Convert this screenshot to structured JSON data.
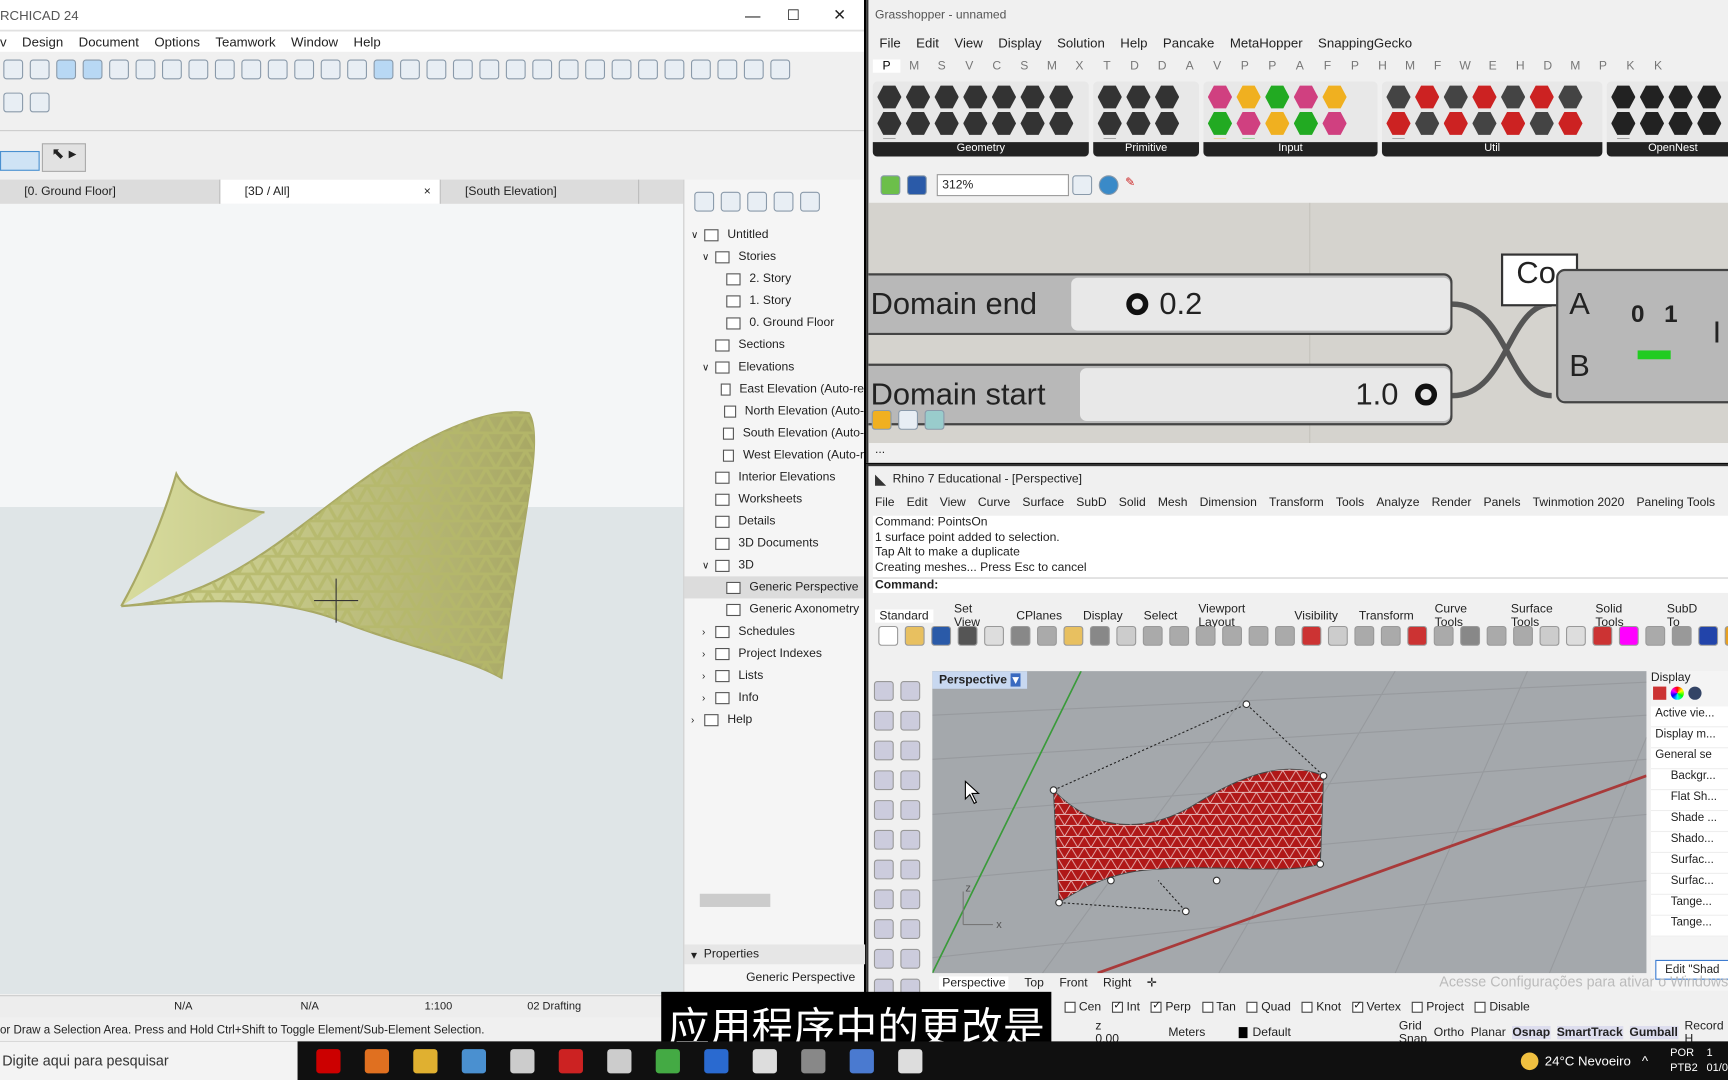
{
  "archicad": {
    "title": "RCHICAD 24",
    "menu": [
      "v",
      "Design",
      "Document",
      "Options",
      "Teamwork",
      "Window",
      "Help"
    ],
    "tabs": [
      {
        "label": "[0. Ground Floor]"
      },
      {
        "label": "[3D / All]",
        "close": "×"
      },
      {
        "label": "[South Elevation]"
      }
    ],
    "navigator": [
      {
        "label": "Untitled",
        "depth": 0,
        "exp": "v"
      },
      {
        "label": "Stories",
        "depth": 1,
        "exp": "v"
      },
      {
        "label": "2. Story",
        "depth": 2
      },
      {
        "label": "1. Story",
        "depth": 2
      },
      {
        "label": "0. Ground Floor",
        "depth": 2
      },
      {
        "label": "Sections",
        "depth": 1
      },
      {
        "label": "Elevations",
        "depth": 1,
        "exp": "v"
      },
      {
        "label": "East Elevation (Auto-re",
        "depth": 2
      },
      {
        "label": "North Elevation (Auto-",
        "depth": 2
      },
      {
        "label": "South Elevation (Auto-",
        "depth": 2
      },
      {
        "label": "West Elevation (Auto-r",
        "depth": 2
      },
      {
        "label": "Interior Elevations",
        "depth": 1
      },
      {
        "label": "Worksheets",
        "depth": 1
      },
      {
        "label": "Details",
        "depth": 1
      },
      {
        "label": "3D Documents",
        "depth": 1
      },
      {
        "label": "3D",
        "depth": 1,
        "exp": "v"
      },
      {
        "label": "Generic Perspective",
        "depth": 2,
        "selected": true
      },
      {
        "label": "Generic Axonometry",
        "depth": 2
      },
      {
        "label": "Schedules",
        "depth": 1,
        "exp": ">"
      },
      {
        "label": "Project Indexes",
        "depth": 1,
        "exp": ">"
      },
      {
        "label": "Lists",
        "depth": 1,
        "exp": ">"
      },
      {
        "label": "Info",
        "depth": 1,
        "exp": ">"
      },
      {
        "label": "Help",
        "depth": 0,
        "exp": ">"
      }
    ],
    "properties_label": "Properties",
    "properties_value": "Generic Perspective",
    "bottom": {
      "na1": "N/A",
      "na2": "N/A",
      "scale": "1:100",
      "layer": "02 Drafting"
    },
    "status": "or Draw a Selection Area. Press and Hold Ctrl+Shift to Toggle Element/Sub-Element Selection.",
    "mesh_color": "#b5b86a"
  },
  "grasshopper": {
    "title": "Grasshopper - unnamed",
    "menu": [
      "File",
      "Edit",
      "View",
      "Display",
      "Solution",
      "Help",
      "Pancake",
      "MetaHopper",
      "SnappingGecko"
    ],
    "tabs": [
      "P",
      "M",
      "S",
      "V",
      "C",
      "S",
      "M",
      "X",
      "T",
      "D",
      "D",
      "A",
      "V",
      "P",
      "P",
      "A",
      "F",
      "P",
      "H",
      "M",
      "F",
      "W",
      "E",
      "H",
      "D",
      "M",
      "P",
      "K",
      "K"
    ],
    "groups": [
      "Geometry",
      "Primitive",
      "Input",
      "Util",
      "OpenNest"
    ],
    "zoom": "312%",
    "slider_end": {
      "label": "Domain end",
      "value": "0.2"
    },
    "slider_start": {
      "label": "Domain start",
      "value": "1.0"
    },
    "component": {
      "title": "Co",
      "in_a": "A",
      "in_b": "B",
      "n0": "0",
      "n1": "1",
      "out": "I"
    },
    "status": "..."
  },
  "rhino": {
    "title": "Rhino 7 Educational - [Perspective]",
    "menu": [
      "File",
      "Edit",
      "View",
      "Curve",
      "Surface",
      "SubD",
      "Solid",
      "Mesh",
      "Dimension",
      "Transform",
      "Tools",
      "Analyze",
      "Render",
      "Panels",
      "Twinmotion 2020",
      "Paneling Tools"
    ],
    "history": [
      "Command: PointsOn",
      "1 surface point added to selection.",
      "Tap Alt to make a duplicate",
      "Creating meshes... Press Esc to cancel"
    ],
    "command_label": "Command:",
    "toolbar_tabs": [
      "Standard",
      "Set View",
      "CPlanes",
      "Display",
      "Select",
      "Viewport Layout",
      "Visibility",
      "Transform",
      "Curve Tools",
      "Surface Tools",
      "Solid Tools",
      "SubD To"
    ],
    "viewport_label": "Perspective",
    "viewport_tabs": [
      "Perspective",
      "Top",
      "Front",
      "Right"
    ],
    "display_panel": {
      "title": "Display",
      "items": [
        "Active vie...",
        "Display m...",
        "General se",
        "Backgr...",
        "Flat Sh...",
        "Shade ...",
        "Shado...",
        "Surfac...",
        "Surfac...",
        "Tange...",
        "Tange..."
      ],
      "edit_button": "Edit \"Shad"
    },
    "watermark": "Acesse Configurações para ativar o Windows",
    "osnap": [
      {
        "label": "Cen",
        "on": false
      },
      {
        "label": "Int",
        "on": true
      },
      {
        "label": "Perp",
        "on": true
      },
      {
        "label": "Tan",
        "on": false
      },
      {
        "label": "Quad",
        "on": false
      },
      {
        "label": "Knot",
        "on": false
      },
      {
        "label": "Vertex",
        "on": true
      },
      {
        "label": "Project",
        "on": false
      },
      {
        "label": "Disable",
        "on": false
      }
    ],
    "status": {
      "z": "z 0.00",
      "units": "Meters",
      "layer": "Default",
      "items": [
        "Grid Snap",
        "Ortho",
        "Planar",
        "Osnap",
        "SmartTrack",
        "Gumball",
        "Record H"
      ]
    },
    "mesh_color": "#b01818",
    "axis_x": "x",
    "axis_z": "z"
  },
  "subtitle": "应用程序中的更改是",
  "taskbar": {
    "search": "Digite aqui para pesquisar",
    "weather": "24°C  Nevoeiro",
    "lang": "POR",
    "layout": "PTB2",
    "time": "1",
    "date": "01/0"
  }
}
